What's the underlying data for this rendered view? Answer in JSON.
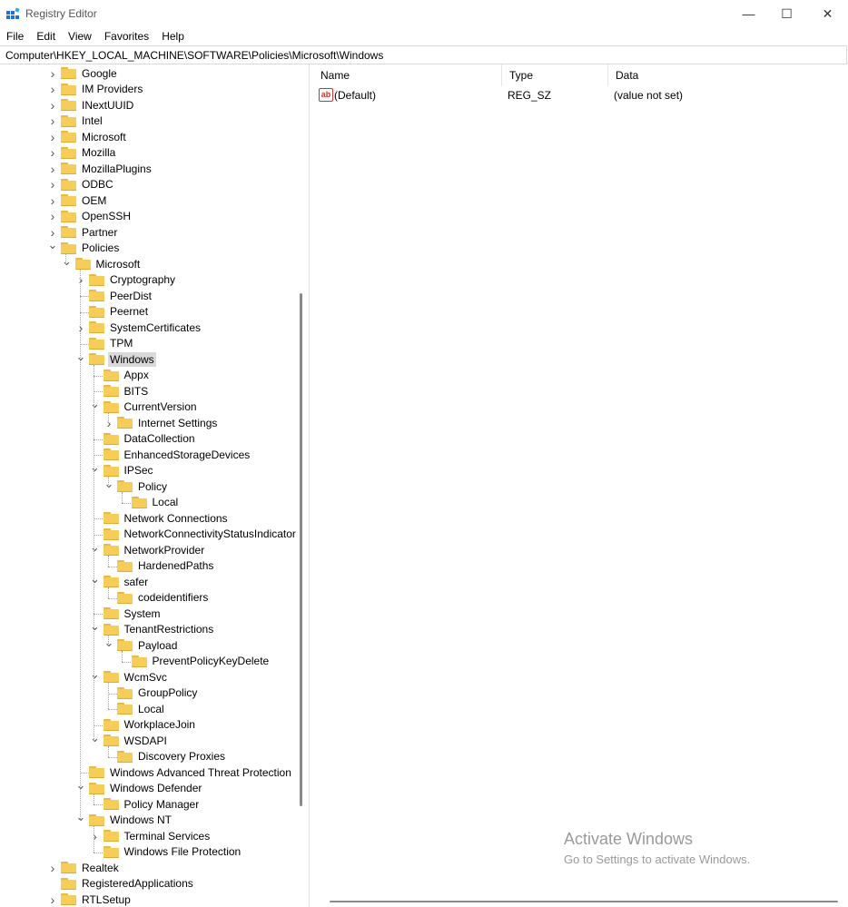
{
  "window": {
    "title": "Registry Editor",
    "minimize": "—",
    "maximize": "☐",
    "close": "✕"
  },
  "menu": [
    "File",
    "Edit",
    "View",
    "Favorites",
    "Help"
  ],
  "address": "Computer\\HKEY_LOCAL_MACHINE\\SOFTWARE\\Policies\\Microsoft\\Windows",
  "tree": [
    {
      "label": "Google",
      "depth": 0,
      "state": "collapsed"
    },
    {
      "label": "IM Providers",
      "depth": 0,
      "state": "collapsed"
    },
    {
      "label": "INextUUID",
      "depth": 0,
      "state": "collapsed"
    },
    {
      "label": "Intel",
      "depth": 0,
      "state": "collapsed"
    },
    {
      "label": "Microsoft",
      "depth": 0,
      "state": "collapsed"
    },
    {
      "label": "Mozilla",
      "depth": 0,
      "state": "collapsed"
    },
    {
      "label": "MozillaPlugins",
      "depth": 0,
      "state": "collapsed"
    },
    {
      "label": "ODBC",
      "depth": 0,
      "state": "collapsed"
    },
    {
      "label": "OEM",
      "depth": 0,
      "state": "collapsed"
    },
    {
      "label": "OpenSSH",
      "depth": 0,
      "state": "collapsed"
    },
    {
      "label": "Partner",
      "depth": 0,
      "state": "collapsed"
    },
    {
      "label": "Policies",
      "depth": 0,
      "state": "expanded"
    },
    {
      "label": "Microsoft",
      "depth": 1,
      "state": "expanded"
    },
    {
      "label": "Cryptography",
      "depth": 2,
      "state": "collapsed"
    },
    {
      "label": "PeerDist",
      "depth": 2,
      "state": "leaf"
    },
    {
      "label": "Peernet",
      "depth": 2,
      "state": "leaf"
    },
    {
      "label": "SystemCertificates",
      "depth": 2,
      "state": "collapsed"
    },
    {
      "label": "TPM",
      "depth": 2,
      "state": "leaf"
    },
    {
      "label": "Windows",
      "depth": 2,
      "state": "expanded",
      "selected": true
    },
    {
      "label": "Appx",
      "depth": 3,
      "state": "leaf"
    },
    {
      "label": "BITS",
      "depth": 3,
      "state": "leaf"
    },
    {
      "label": "CurrentVersion",
      "depth": 3,
      "state": "expanded"
    },
    {
      "label": "Internet Settings",
      "depth": 4,
      "state": "collapsed"
    },
    {
      "label": "DataCollection",
      "depth": 3,
      "state": "leaf"
    },
    {
      "label": "EnhancedStorageDevices",
      "depth": 3,
      "state": "leaf"
    },
    {
      "label": "IPSec",
      "depth": 3,
      "state": "expanded"
    },
    {
      "label": "Policy",
      "depth": 4,
      "state": "expanded"
    },
    {
      "label": "Local",
      "depth": 5,
      "state": "leaf"
    },
    {
      "label": "Network Connections",
      "depth": 3,
      "state": "leaf"
    },
    {
      "label": "NetworkConnectivityStatusIndicator",
      "depth": 3,
      "state": "leaf"
    },
    {
      "label": "NetworkProvider",
      "depth": 3,
      "state": "expanded"
    },
    {
      "label": "HardenedPaths",
      "depth": 4,
      "state": "leaf"
    },
    {
      "label": "safer",
      "depth": 3,
      "state": "expanded"
    },
    {
      "label": "codeidentifiers",
      "depth": 4,
      "state": "leaf"
    },
    {
      "label": "System",
      "depth": 3,
      "state": "leaf"
    },
    {
      "label": "TenantRestrictions",
      "depth": 3,
      "state": "expanded"
    },
    {
      "label": "Payload",
      "depth": 4,
      "state": "expanded"
    },
    {
      "label": "PreventPolicyKeyDelete",
      "depth": 5,
      "state": "leaf"
    },
    {
      "label": "WcmSvc",
      "depth": 3,
      "state": "expanded"
    },
    {
      "label": "GroupPolicy",
      "depth": 4,
      "state": "leaf"
    },
    {
      "label": "Local",
      "depth": 4,
      "state": "leaf"
    },
    {
      "label": "WorkplaceJoin",
      "depth": 3,
      "state": "leaf"
    },
    {
      "label": "WSDAPI",
      "depth": 3,
      "state": "expanded"
    },
    {
      "label": "Discovery Proxies",
      "depth": 4,
      "state": "leaf"
    },
    {
      "label": "Windows Advanced Threat Protection",
      "depth": 2,
      "state": "leaf"
    },
    {
      "label": "Windows Defender",
      "depth": 2,
      "state": "expanded"
    },
    {
      "label": "Policy Manager",
      "depth": 3,
      "state": "leaf"
    },
    {
      "label": "Windows NT",
      "depth": 2,
      "state": "expanded"
    },
    {
      "label": "Terminal Services",
      "depth": 3,
      "state": "collapsed"
    },
    {
      "label": "Windows File Protection",
      "depth": 3,
      "state": "leaf"
    },
    {
      "label": "Realtek",
      "depth": 0,
      "state": "collapsed"
    },
    {
      "label": "RegisteredApplications",
      "depth": 0,
      "state": "leaf"
    },
    {
      "label": "RTLSetup",
      "depth": 0,
      "state": "collapsed"
    }
  ],
  "columns": {
    "name": "Name",
    "type": "Type",
    "data": "Data"
  },
  "values": [
    {
      "name": "(Default)",
      "type": "REG_SZ",
      "data": "(value not set)",
      "icon": "string-value-icon",
      "icon_text": "ab"
    }
  ],
  "watermark": {
    "title": "Activate Windows",
    "subtitle": "Go to Settings to activate Windows."
  }
}
